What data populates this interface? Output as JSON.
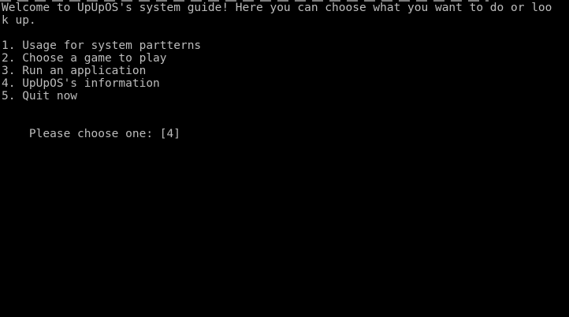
{
  "terminal": {
    "welcome_line_1": "Welcome to UpUpOS's system guide! Here you can choose what you want to do or loo",
    "welcome_line_2": "k up.",
    "menu": [
      "1. Usage for system partterns",
      "2. Choose a game to play",
      "3. Run an application",
      "4. UpUpOS's information",
      "5. Quit now"
    ],
    "prompt_label": "Please choose one: ",
    "prompt_value": "[4]"
  },
  "colors": {
    "background": "#000000",
    "text": "#bcbcbc"
  }
}
